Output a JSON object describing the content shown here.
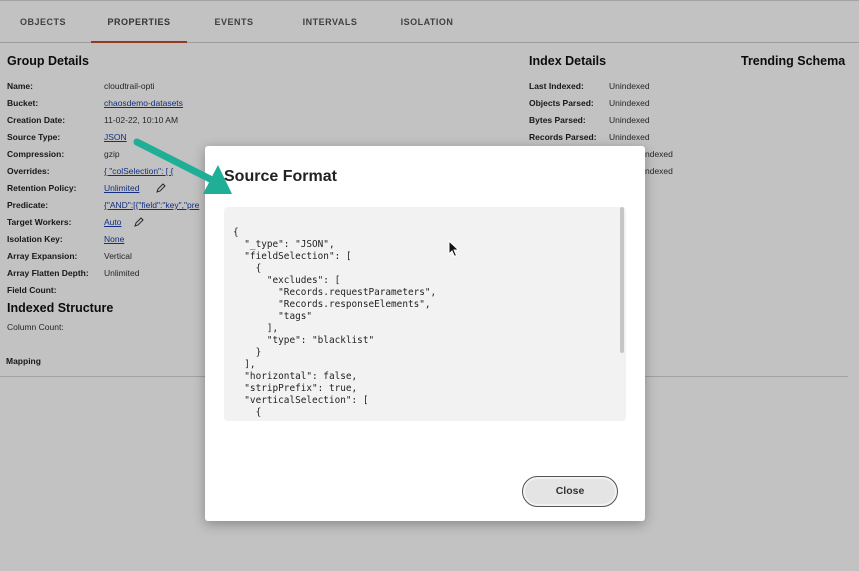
{
  "tabs": [
    "OBJECTS",
    "PROPERTIES",
    "EVENTS",
    "INTERVALS",
    "ISOLATION"
  ],
  "group_details": {
    "title": "Group Details",
    "rows": [
      {
        "label": "Name:",
        "value": "cloudtrail-opti"
      },
      {
        "label": "Bucket:",
        "value": "chaosdemo-datasets"
      },
      {
        "label": "Creation Date:",
        "value": "11-02-22, 10:10 AM"
      },
      {
        "label": "Source Type:",
        "value": "JSON"
      },
      {
        "label": "Compression:",
        "value": "gzip"
      },
      {
        "label": "Overrides:",
        "value": "{ \"colSelection\": [ {"
      },
      {
        "label": "Retention Policy:",
        "value": "Unlimited"
      },
      {
        "label": "Predicate:",
        "value": "{\"AND\":[{\"field\":\"key\",\"pre"
      },
      {
        "label": "Target Workers:",
        "value": "Auto"
      },
      {
        "label": "Isolation Key:",
        "value": "None"
      },
      {
        "label": "Array Expansion:",
        "value": "Vertical"
      },
      {
        "label": "Array Flatten Depth:",
        "value": "Unlimited"
      },
      {
        "label": "Field Count:",
        "value": ""
      }
    ]
  },
  "indexed_structure": {
    "title": "Indexed Structure",
    "column_count_label": "Column Count:"
  },
  "mapping_label": "Mapping",
  "index_details": {
    "title": "Index Details",
    "rows": [
      {
        "label": "Last Indexed:",
        "value": "Unindexed"
      },
      {
        "label": "Objects Parsed:",
        "value": "Unindexed"
      },
      {
        "label": "Bytes Parsed:",
        "value": "Unindexed"
      },
      {
        "label": "Records Parsed:",
        "value": "Unindexed"
      },
      {
        "label": "",
        "value": "ndexed"
      },
      {
        "label": "",
        "value": "ndexed"
      }
    ]
  },
  "trending_schema": {
    "title": "Trending Schema"
  },
  "modal": {
    "title": "Source Format",
    "code": "{\n  \"_type\": \"JSON\",\n  \"fieldSelection\": [\n    {\n      \"excludes\": [\n        \"Records.requestParameters\",\n        \"Records.responseElements\",\n        \"tags\"\n      ],\n      \"type\": \"blacklist\"\n    }\n  ],\n  \"horizontal\": false,\n  \"stripPrefix\": true,\n  \"verticalSelection\": [\n    {",
    "close_label": "Close"
  },
  "colors": {
    "accent_underline": "#c64b2f",
    "link": "#1a3fa8",
    "annotation_arrow": "#1fae96"
  }
}
